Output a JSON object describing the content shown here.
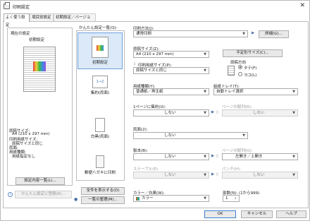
{
  "window": {
    "title": "印刷設定",
    "close": "✕"
  },
  "tabs": [
    "よく使う設定",
    "項目別設定",
    "初期設定／バージョン"
  ],
  "current": {
    "heading": "現在の設定",
    "preset": "初期設定",
    "info": [
      "原稿サイズ:",
      "A4 (210 x 297 mm)",
      "印刷用紙サイズ:",
      "原稿サイズと同じ",
      "両面:",
      "用紙種類:",
      "用紙指定なし"
    ],
    "list_button": "設定内容一覧(L)...",
    "reg_button": "かんたん設定に登録(R)..."
  },
  "presets": {
    "heading": "かんたん設定一覧(Q):",
    "items": [
      "初期設定",
      "集約(両面)",
      "白黒(両面)",
      "郵便八ガキに印刷"
    ],
    "show_all": "全件を表示する(D)",
    "manage": "一覧の整理(M)..."
  },
  "form": {
    "job_label": "印刷方法(J):",
    "job_value": "通常印刷",
    "detail_btn": "詳細(G)...",
    "orig_label": "原稿サイズ(Z):",
    "orig_value": "A4 (210 x 297 mm)",
    "custom_btn": "不定形サイズ(C)...",
    "paper_label": "印刷用紙サイズ(P):",
    "paper_value": "原稿サイズと同じ",
    "orient_label": "原稿方向",
    "orient_portrait": "タテ(F)",
    "orient_landscape": "ヨコ(L)",
    "type_label": "用紙種類(Y):",
    "type_value": "普通紙／再生紙",
    "tray_label": "給紙トレイ(T):",
    "tray_value": "自動トレイ選択",
    "nup_label": "1ページに集約(U):",
    "nup_value": "しない",
    "order_label": "ページの配列(R):",
    "order_value": "しない",
    "duplex_label": "両面(2):",
    "duplex_value": "しない",
    "book_label": "製本(B):",
    "book_value": "しない",
    "pos_label": "ページの配列(O):",
    "pos_value": "左開き／上開き",
    "staple_label": "ステープル(E):",
    "staple_value": "しない",
    "punch_label": "パンチ(H):",
    "punch_value": "しない",
    "color_label": "カラー／白黒(W):",
    "color_value": "カラー",
    "copies_label": "部数(N): (1から999)",
    "copies_value": "1"
  },
  "buttons": {
    "ok": "OK",
    "cancel": "キャンセル",
    "help": "ヘルプ"
  }
}
